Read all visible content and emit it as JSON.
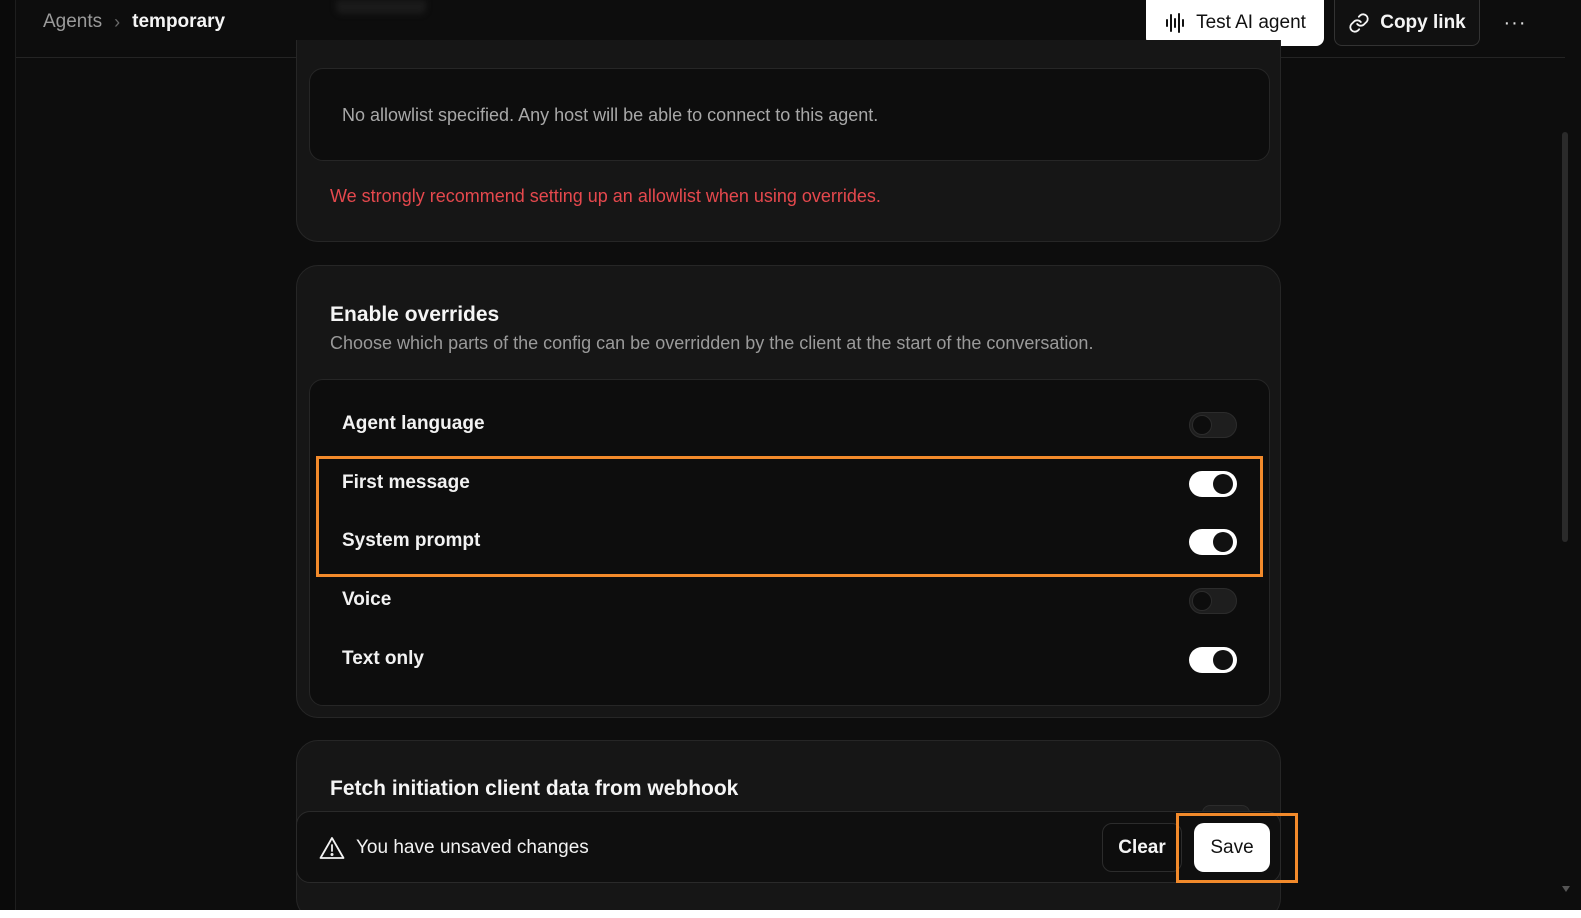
{
  "header": {
    "breadcrumb_root": "Agents",
    "breadcrumb_separator": "›",
    "breadcrumb_current": "temporary",
    "test_button_label": "Test AI agent",
    "copy_link_label": "Copy link",
    "more_label": "···"
  },
  "allowlist": {
    "empty_message": "No allowlist specified. Any host will be able to connect to this agent.",
    "warning": "We strongly recommend setting up an allowlist when using overrides."
  },
  "overrides": {
    "title": "Enable overrides",
    "description": "Choose which parts of the config can be overridden by the client at the start of the conversation.",
    "items": [
      {
        "label": "Agent language",
        "enabled": false
      },
      {
        "label": "First message",
        "enabled": true
      },
      {
        "label": "System prompt",
        "enabled": true
      },
      {
        "label": "Voice",
        "enabled": false
      },
      {
        "label": "Text only",
        "enabled": true
      }
    ]
  },
  "webhook": {
    "title": "Fetch initiation client data from webhook"
  },
  "unsaved": {
    "message": "You have unsaved changes",
    "clear_label": "Clear",
    "save_label": "Save"
  },
  "colors": {
    "background": "#0d0d0d",
    "card": "#161616",
    "warning_red": "#e5484d",
    "highlight_orange": "#f28a2b",
    "toggle_on": "#ffffff"
  },
  "icons": {
    "test_button_icon": "waveform-icon",
    "copy_link_icon": "link-icon",
    "unsaved_icon": "warning-triangle-icon"
  }
}
